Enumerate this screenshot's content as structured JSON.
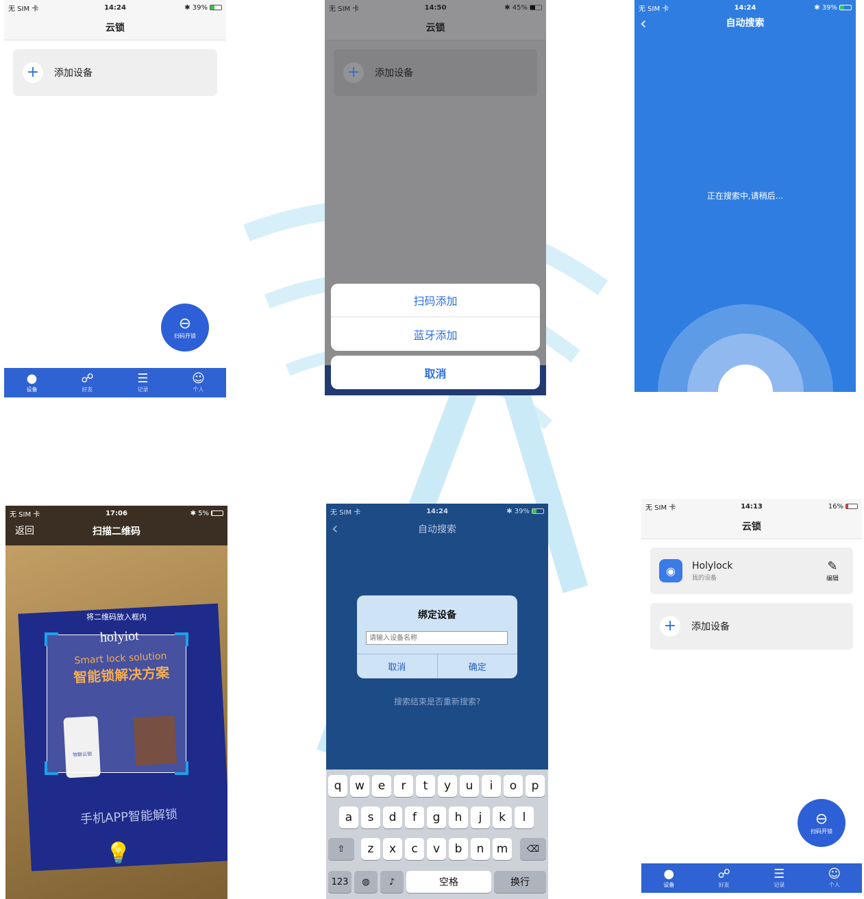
{
  "status_bars": {
    "s1": {
      "carrier": "无 SIM 卡",
      "time": "14:24",
      "battery": "39%"
    },
    "s2": {
      "carrier": "无 SIM 卡",
      "time": "14:50",
      "battery": "45%"
    },
    "s3": {
      "carrier": "无 SIM 卡",
      "time": "14:24",
      "battery": "39%"
    },
    "s4": {
      "carrier": "无 SIM 卡",
      "time": "17:06",
      "battery": "5%"
    },
    "s5": {
      "carrier": "无 SIM 卡",
      "time": "14:24",
      "battery": "39%"
    },
    "s6": {
      "carrier": "无 SIM 卡",
      "time": "14:13",
      "battery": "16%"
    }
  },
  "home": {
    "title": "云锁",
    "add_device": "添加设备",
    "fab_label": "扫码开锁",
    "tabs": [
      "设备",
      "好友",
      "记录",
      "个人"
    ]
  },
  "action_sheet": {
    "items": [
      "扫码添加",
      "蓝牙添加"
    ],
    "cancel": "取消"
  },
  "auto_search": {
    "title": "自动搜索",
    "searching": "正在搜索中,请稍后..."
  },
  "scanner": {
    "back": "返回",
    "title": "扫描二维码",
    "hint": "将二维码放入框内",
    "poster": {
      "brand": "holyiot",
      "tagline": "Smart lock solution",
      "headline": "智能锁解决方案",
      "phone_label": "物联云锁",
      "footer": "手机APP智能解锁"
    }
  },
  "bind_dialog": {
    "nav_title": "自动搜索",
    "title": "绑定设备",
    "placeholder": "请输入设备名称",
    "cancel": "取消",
    "confirm": "确定",
    "research_prompt": "搜索结束是否重新搜索?",
    "keyboard": {
      "row1": [
        "q",
        "w",
        "e",
        "r",
        "t",
        "y",
        "u",
        "i",
        "o",
        "p"
      ],
      "row2": [
        "a",
        "s",
        "d",
        "f",
        "g",
        "h",
        "j",
        "k",
        "l"
      ],
      "row3": [
        "z",
        "x",
        "c",
        "v",
        "b",
        "n",
        "m"
      ],
      "num": "123",
      "space": "空格",
      "return": "换行"
    }
  },
  "device_list": {
    "title": "云锁",
    "device_name": "Holylock",
    "device_sub": "我的设备",
    "edit": "编辑",
    "add_device": "添加设备",
    "fab_label": "扫码开锁",
    "tabs": [
      "设备",
      "好友",
      "记录",
      "个人"
    ]
  },
  "colors": {
    "accent": "#2f62d2",
    "search_bg": "#2f7de0",
    "dialog_bg": "#1c4b86"
  }
}
